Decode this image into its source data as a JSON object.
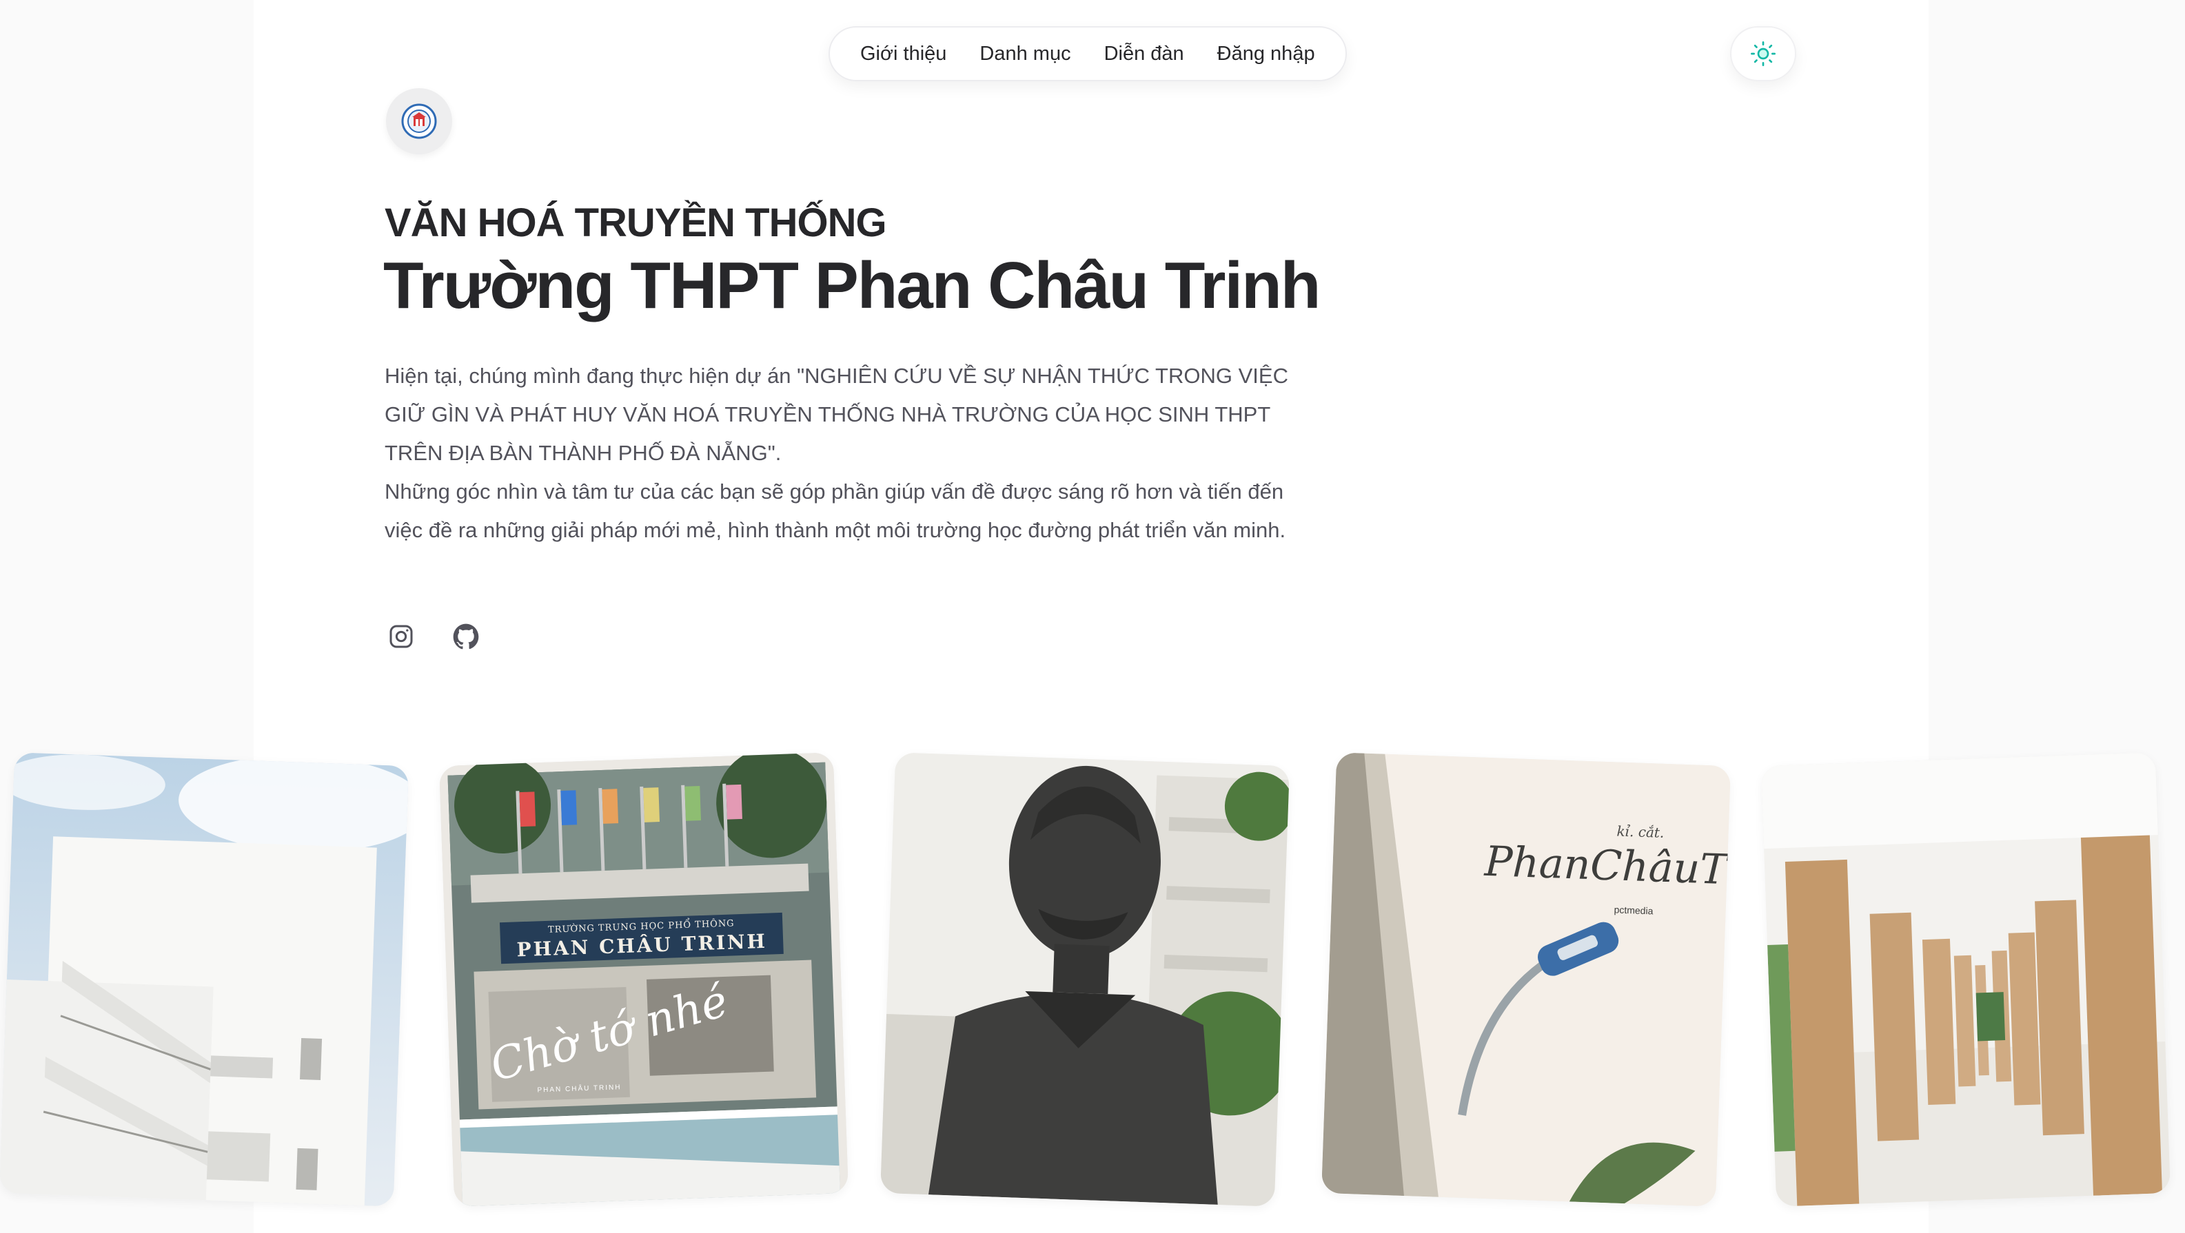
{
  "nav": {
    "items": [
      {
        "label": "Giới thiệu"
      },
      {
        "label": "Danh mục"
      },
      {
        "label": "Diễn đàn"
      },
      {
        "label": "Đăng nhập"
      }
    ]
  },
  "theme_toggle": {
    "icon": "sun-icon"
  },
  "avatar": {
    "icon": "school-logo"
  },
  "hero": {
    "eyebrow": "VĂN HOÁ TRUYỀN THỐNG",
    "title": "Trường THPT Phan Châu Trinh",
    "paragraph1": "Hiện tại, chúng mình đang thực hiện dự án \"NGHIÊN CỨU VỀ SỰ NHẬN THỨC TRONG VIỆC GIỮ GÌN VÀ PHÁT HUY VĂN HOÁ TRUYỀN THỐNG NHÀ TRƯỜNG CỦA HỌC SINH THPT TRÊN ĐỊA BÀN THÀNH PHỐ ĐÀ NẴNG\".",
    "paragraph2": "Những góc nhìn và tâm tư của các bạn sẽ góp phần giúp vấn đề được sáng rõ hơn và tiến đến việc đề ra những giải pháp mới mẻ, hình thành một môi trường học đường phát triển văn minh."
  },
  "socials": [
    {
      "icon": "instagram-icon"
    },
    {
      "icon": "github-icon"
    }
  ],
  "photos": [
    {
      "name": "building-staircase"
    },
    {
      "name": "school-gate",
      "sign_top": "TRƯỜNG TRUNG HỌC PHỔ THÔNG",
      "sign_main": "PHAN CHÂU TRINH",
      "script": "Chờ tớ nhé",
      "small": "PHAN CHÂU TRINH"
    },
    {
      "name": "bust-statue"
    },
    {
      "name": "street-lamp",
      "small_top": "kỉ. cắt.",
      "script": "PhanChâuTrinh",
      "brand": "pctmedia"
    },
    {
      "name": "corridor-columns"
    }
  ],
  "colors": {
    "accent": "#14b8a6",
    "text": "#27272a",
    "muted": "#52525b",
    "background": "#fafafa"
  }
}
